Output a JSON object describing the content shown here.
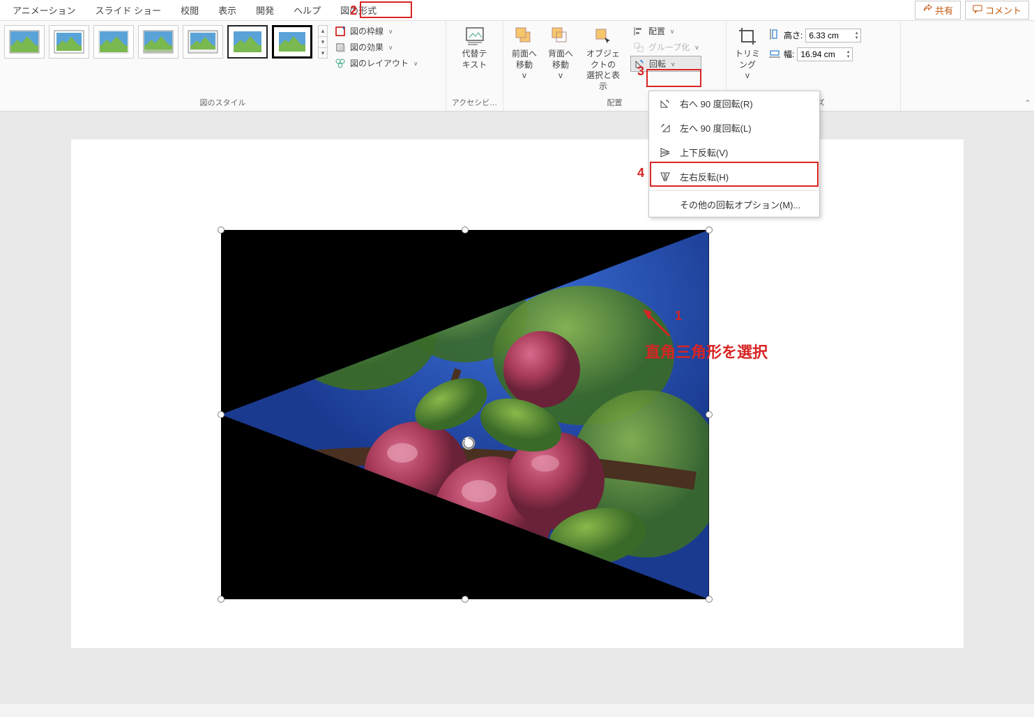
{
  "tabs": {
    "animation": "アニメーション",
    "slideshow": "スライド ショー",
    "review": "校閲",
    "view": "表示",
    "developer": "開発",
    "help": "ヘルプ",
    "picture_format": "図の形式"
  },
  "topright": {
    "share": "共有",
    "comment": "コメント"
  },
  "ribbon": {
    "styles_label": "図のスタイル",
    "border": "図の枠線",
    "effects": "図の効果",
    "layout": "図のレイアウト",
    "alt_text": "代替テ\nキスト",
    "access_label": "アクセシビ…",
    "bring_forward": "前面へ\n移動",
    "send_backward": "背面へ\n移動",
    "selection_pane": "オブジェクトの\n選択と表示",
    "align": "配置",
    "group": "グループ化",
    "rotate": "回転",
    "arrange_label": "配置",
    "crop": "トリミング",
    "height_label": "高さ:",
    "height_value": "6.33 cm",
    "width_label": "幅:",
    "width_value": "16.94 cm",
    "size_label": "サイズ"
  },
  "dropdown": {
    "rotate_right": "右へ 90 度回転(R)",
    "rotate_left": "左へ 90 度回転(L)",
    "flip_vertical": "上下反転(V)",
    "flip_horizontal": "左右反転(H)",
    "more": "その他の回転オプション(M)..."
  },
  "annotations": {
    "n1": "1",
    "n2": "2",
    "n3": "3",
    "n4": "4",
    "text1": "直角三角形を選択"
  }
}
